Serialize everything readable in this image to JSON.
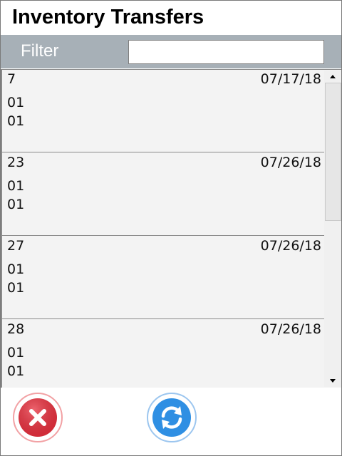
{
  "app": {
    "title": "Inventory Transfers"
  },
  "filter": {
    "label": "Filter",
    "value": ""
  },
  "transfers": [
    {
      "id": "7",
      "date": "07/17/18",
      "line1": "01",
      "line2": "01"
    },
    {
      "id": "23",
      "date": "07/26/18",
      "line1": "01",
      "line2": "01"
    },
    {
      "id": "27",
      "date": "07/26/18",
      "line1": "01",
      "line2": "01"
    },
    {
      "id": "28",
      "date": "07/26/18",
      "line1": "01",
      "line2": "01"
    }
  ],
  "scrollbar": {
    "position_fraction": 0.0
  },
  "actions": [
    {
      "icon": "close-icon",
      "color": "#e8303e"
    },
    {
      "icon": "refresh-icon",
      "color": "#2f8fe3"
    }
  ]
}
